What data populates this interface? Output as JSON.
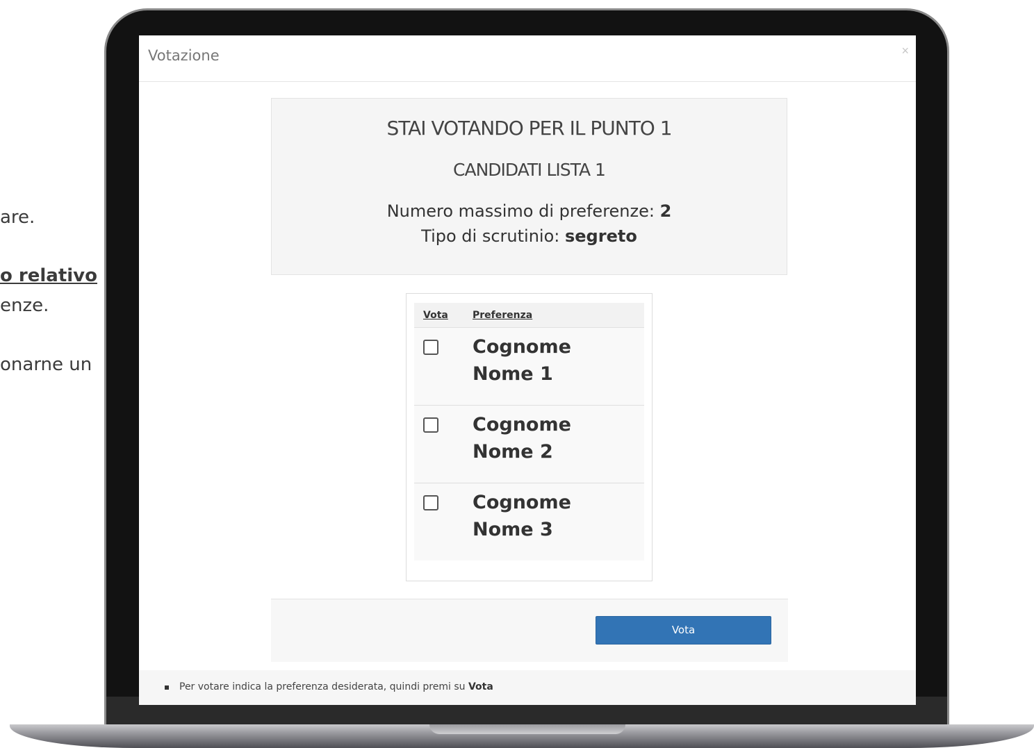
{
  "background_text": {
    "line1": "are.",
    "line2": "o relativo",
    "line3": "enze.",
    "line4": "onarne un"
  },
  "modal": {
    "title": "Votazione",
    "close_glyph": "×"
  },
  "info": {
    "title": "STAI VOTANDO PER IL PUNTO 1",
    "list_name": "CANDIDATI LISTA 1",
    "max_label": "Numero massimo di preferenze: ",
    "max_value": "2",
    "type_label": "Tipo di scrutinio: ",
    "type_value": "segreto"
  },
  "table": {
    "col_vote": "Vota",
    "col_pref": "Preferenza",
    "rows": [
      {
        "name": "Cognome Nome 1",
        "checked": false
      },
      {
        "name": "Cognome Nome 2",
        "checked": false
      },
      {
        "name": "Cognome Nome 3",
        "checked": false
      }
    ]
  },
  "footer": {
    "vote_label": "Vota"
  },
  "help": {
    "text_before": "Per votare indica la preferenza desiderata, quindi premi su ",
    "text_bold": "Vota"
  },
  "colors": {
    "primary_button": "#3274b5",
    "laptop_frame": "#121212"
  }
}
